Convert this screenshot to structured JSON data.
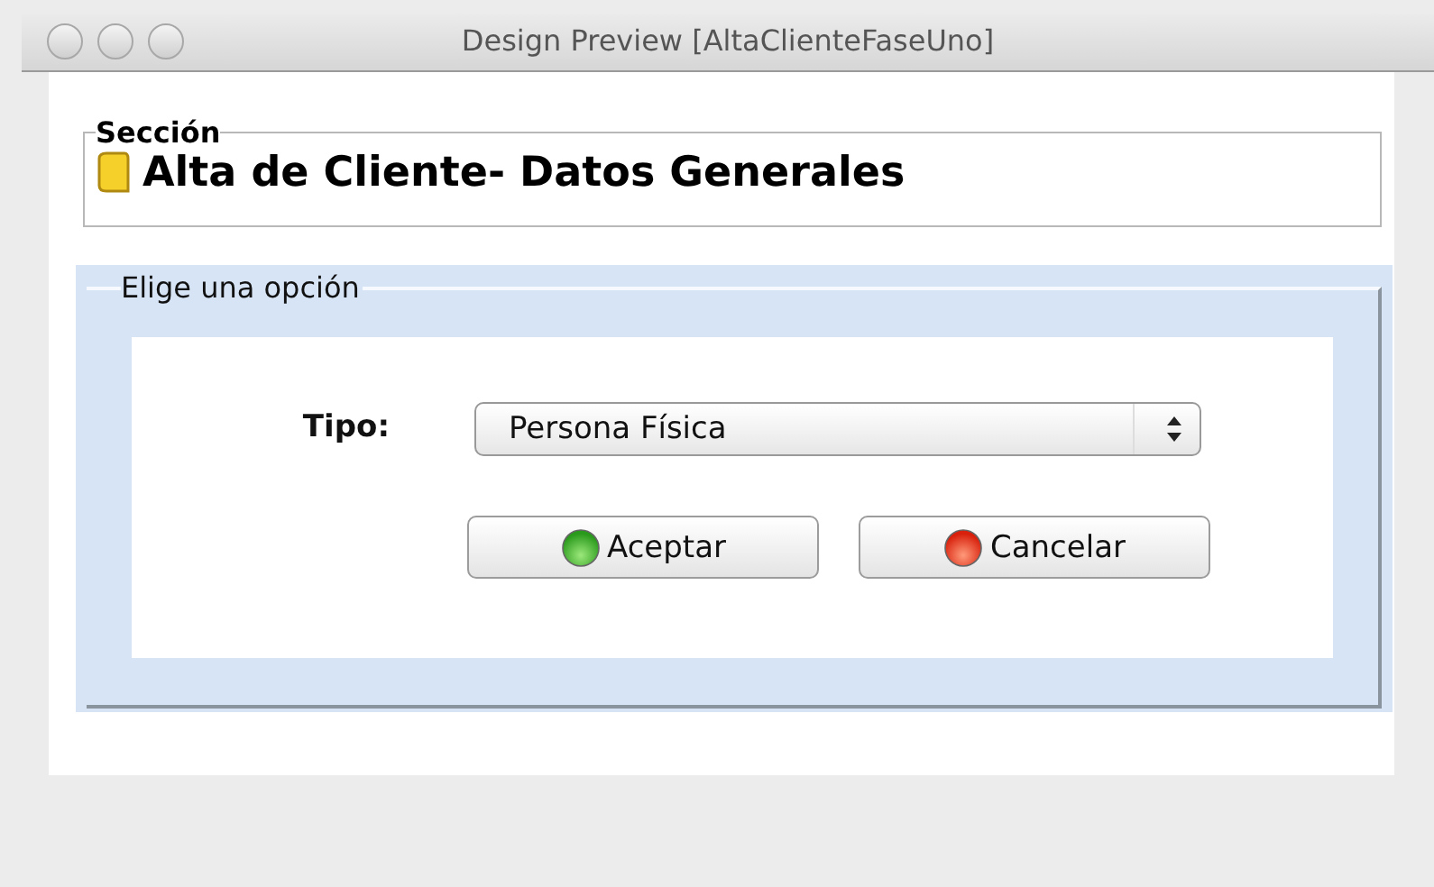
{
  "window": {
    "title": "Design Preview [AltaClienteFaseUno]"
  },
  "section": {
    "legend": "Sección",
    "heading": "Alta de Cliente- Datos Generales"
  },
  "options": {
    "legend": "Elige una opción",
    "type_label": "Tipo:",
    "type_value": "Persona Física",
    "buttons": [
      {
        "label": "Aceptar",
        "kind": "accept"
      },
      {
        "label": "Cancelar",
        "kind": "cancel"
      }
    ]
  }
}
